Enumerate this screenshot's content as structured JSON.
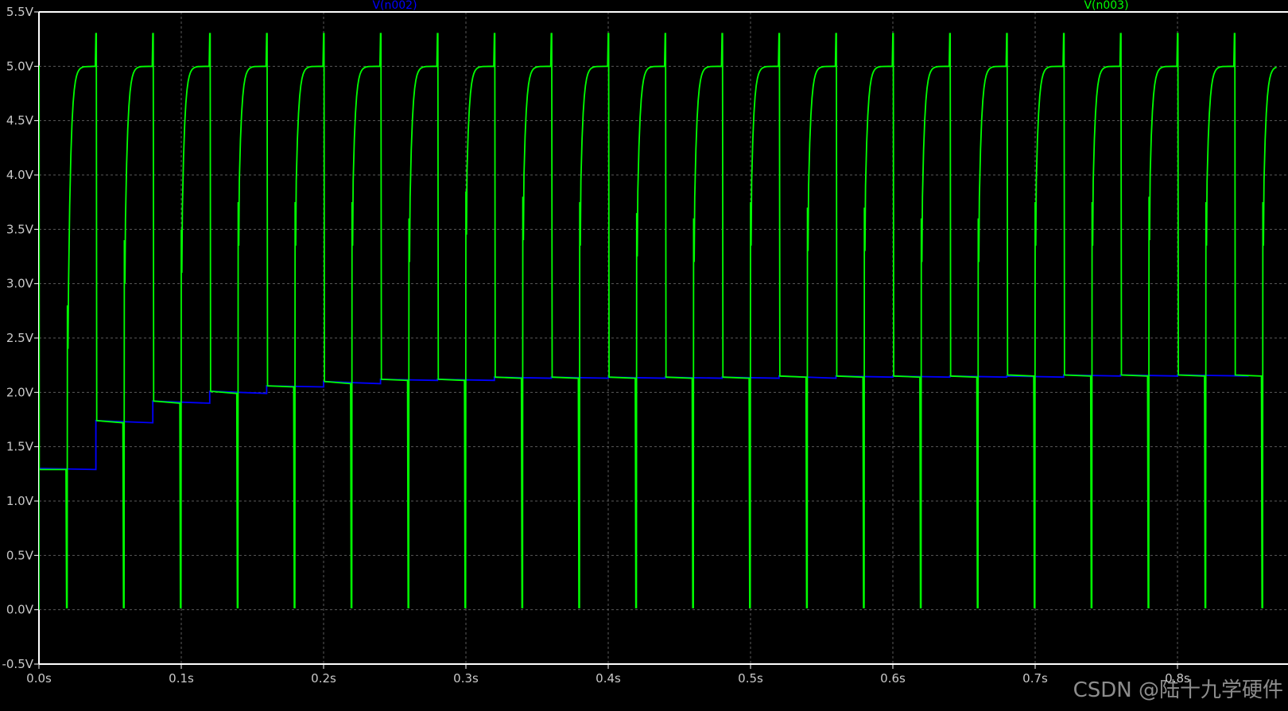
{
  "watermark": "CSDN @陆十九学硬件",
  "colors": {
    "background": "#000000",
    "frame": "#ffffff",
    "grid": "#5a5a5a",
    "tick_text": "#c8c8c8"
  },
  "chart_data": {
    "type": "line",
    "title": "",
    "xlabel": "",
    "ylabel": "",
    "xlim": [
      0.0,
      0.85
    ],
    "ylim": [
      -0.5,
      5.5
    ],
    "x_ticks": [
      0.0,
      0.1,
      0.2,
      0.3,
      0.4,
      0.5,
      0.6,
      0.7,
      0.8
    ],
    "x_tick_labels": [
      "0.0s",
      "0.1s",
      "0.2s",
      "0.3s",
      "0.4s",
      "0.5s",
      "0.6s",
      "0.7s",
      "0.8s"
    ],
    "y_ticks": [
      5.5,
      5.0,
      4.5,
      4.0,
      3.5,
      3.0,
      2.5,
      2.0,
      1.5,
      1.0,
      0.5,
      0.0,
      -0.5
    ],
    "y_tick_labels": [
      "5.5V",
      "5.0V",
      "4.5V",
      "4.0V",
      "3.5V",
      "3.0V",
      "2.5V",
      "2.0V",
      "1.5V",
      "1.0V",
      "0.5V",
      "0.0V",
      "-0.5V"
    ],
    "grid": true,
    "legend": "top, above plot",
    "series": [
      {
        "name": "V(n002)",
        "color": "#0000ff",
        "label_at_x": 0.25,
        "x": [
          0.0,
          0.0,
          0.04,
          0.04,
          0.08,
          0.08,
          0.12,
          0.12,
          0.16,
          0.16,
          0.2,
          0.2,
          0.24,
          0.24,
          0.28,
          0.28,
          0.32,
          0.32,
          0.36,
          0.36,
          0.4,
          0.4,
          0.44,
          0.44,
          0.48,
          0.48,
          0.52,
          0.52,
          0.56,
          0.56,
          0.6,
          0.6,
          0.64,
          0.64,
          0.68,
          0.68,
          0.72,
          0.72,
          0.76,
          0.76,
          0.8,
          0.8,
          0.85
        ],
        "y": [
          0.0,
          1.3,
          1.29,
          1.74,
          1.72,
          1.92,
          1.9,
          2.01,
          1.99,
          2.06,
          2.05,
          2.1,
          2.08,
          2.12,
          2.11,
          2.12,
          2.11,
          2.14,
          2.13,
          2.14,
          2.13,
          2.14,
          2.13,
          2.14,
          2.13,
          2.14,
          2.13,
          2.15,
          2.13,
          2.15,
          2.14,
          2.15,
          2.14,
          2.15,
          2.14,
          2.15,
          2.14,
          2.16,
          2.15,
          2.16,
          2.15,
          2.16,
          2.15
        ]
      },
      {
        "name": "V(n003)",
        "color": "#00ff00",
        "label_at_x": 0.75,
        "period": 0.04,
        "high": 5.0,
        "spike_peak": 5.3,
        "floor": 0.02,
        "plateau_start": [
          1.29,
          1.74,
          1.92,
          2.01,
          2.06,
          2.1,
          2.12,
          2.12,
          2.14,
          2.14,
          2.14,
          2.14,
          2.14,
          2.15,
          2.15,
          2.15,
          2.15,
          2.16,
          2.16,
          2.16,
          2.16,
          2.16
        ],
        "plateau_end": [
          1.29,
          1.72,
          1.9,
          1.99,
          2.05,
          2.08,
          2.11,
          2.11,
          2.13,
          2.13,
          2.13,
          2.13,
          2.13,
          2.14,
          2.14,
          2.14,
          2.14,
          2.15,
          2.15,
          2.15,
          2.15,
          2.15
        ],
        "rise_start": [
          0.02,
          0.06,
          0.1,
          0.14,
          0.18,
          0.22,
          0.26,
          0.3,
          0.34,
          0.38,
          0.42,
          0.46,
          0.5,
          0.54,
          0.58,
          0.62,
          0.66,
          0.7,
          0.74,
          0.78,
          0.82
        ],
        "rise_overshoot": [
          2.8,
          3.4,
          3.5,
          3.75,
          3.75,
          3.75,
          3.6,
          3.85,
          3.8,
          3.75,
          3.65,
          3.6,
          3.75,
          3.7,
          3.7,
          3.6,
          3.6,
          3.75,
          3.75,
          3.8,
          3.75
        ]
      }
    ]
  }
}
